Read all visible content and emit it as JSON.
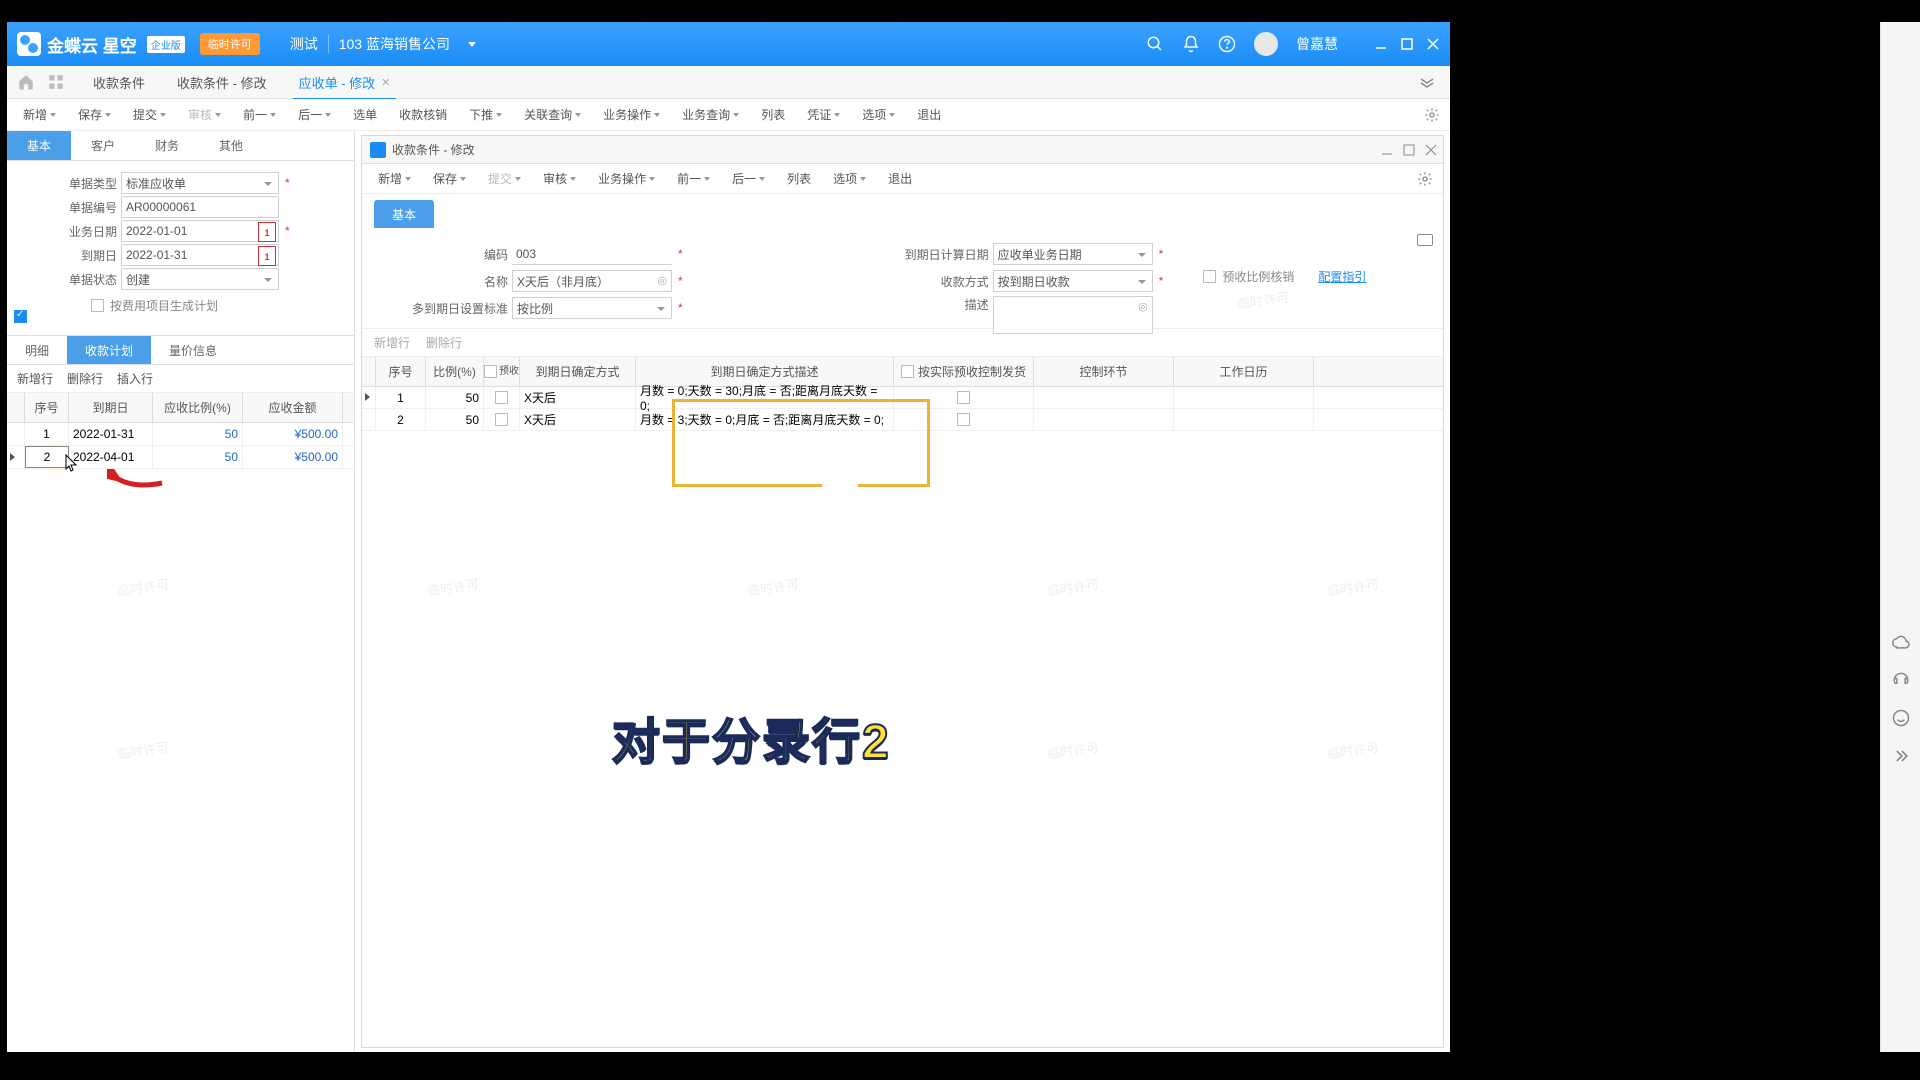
{
  "titlebar": {
    "brand": "金蝶云 星空",
    "edition": "企业版",
    "license": "临时许可",
    "test_env": "测试",
    "org": "103  蓝海销售公司",
    "user": "曾嘉慧"
  },
  "tabs": [
    {
      "label": "收款条件",
      "active": false
    },
    {
      "label": "收款条件 - 修改",
      "active": false
    },
    {
      "label": "应收单 - 修改",
      "active": true
    }
  ],
  "toolbar": [
    "新增",
    "保存",
    "提交",
    "审核",
    "前一",
    "后一",
    "选单",
    "收款核销",
    "下推",
    "关联查询",
    "业务操作",
    "业务查询",
    "列表",
    "凭证",
    "选项",
    "退出"
  ],
  "left_tabs": [
    "基本",
    "客户",
    "财务",
    "其他"
  ],
  "form": {
    "doc_type_label": "单据类型",
    "doc_type": "标准应收单",
    "doc_no_label": "单据编号",
    "doc_no": "AR00000061",
    "biz_date_label": "业务日期",
    "biz_date": "2022-01-01",
    "due_date_label": "到期日",
    "due_date": "2022-01-31",
    "status_label": "单据状态",
    "status": "创建",
    "by_fee_label": "按费用项目生成计划"
  },
  "sub_tabs": [
    "明细",
    "收款计划",
    "量价信息"
  ],
  "row_ops": [
    "新增行",
    "删除行",
    "插入行"
  ],
  "left_grid": {
    "headers": [
      "序号",
      "到期日",
      "应收比例(%)",
      "应收金额"
    ],
    "rows": [
      {
        "seq": "1",
        "date": "2022-01-31",
        "pct": "50",
        "amt": "¥500.00"
      },
      {
        "seq": "2",
        "date": "2022-04-01",
        "pct": "50",
        "amt": "¥500.00"
      }
    ]
  },
  "panel": {
    "title": "收款条件 - 修改",
    "toolbar": [
      "新增",
      "保存",
      "提交",
      "审核",
      "业务操作",
      "前一",
      "后一",
      "列表",
      "选项",
      "退出"
    ],
    "basic_tab": "基本",
    "form": {
      "code_label": "编码",
      "code": "003",
      "name_label": "名称",
      "name": "X天后（非月底）",
      "multi_label": "多到期日设置标准",
      "multi": "按比例",
      "calc_label": "到期日计算日期",
      "calc": "应收单业务日期",
      "method_label": "收款方式",
      "method": "按到期日收款",
      "desc_label": "描述",
      "desc": "",
      "pre_ratio_label": "预收比例核销",
      "guide_label": "配置指引"
    },
    "row_ops": [
      "新增行",
      "删除行"
    ],
    "grid": {
      "headers": [
        "序号",
        "比例(%)",
        "预收",
        "到期日确定方式",
        "到期日确定方式描述",
        "按实际预收控制发货",
        "控制环节",
        "工作日历"
      ],
      "rows": [
        {
          "seq": "1",
          "pct": "50",
          "way": "X天后",
          "desc": "月数 = 0;天数 = 30;月底 = 否;距离月底天数 = 0;"
        },
        {
          "seq": "2",
          "pct": "50",
          "way": "X天后",
          "desc": "月数 = 3;天数 = 0;月底 = 否;距离月底天数 = 0;"
        }
      ]
    }
  },
  "caption": "对于分录行2",
  "watermark_text": "临时许可"
}
